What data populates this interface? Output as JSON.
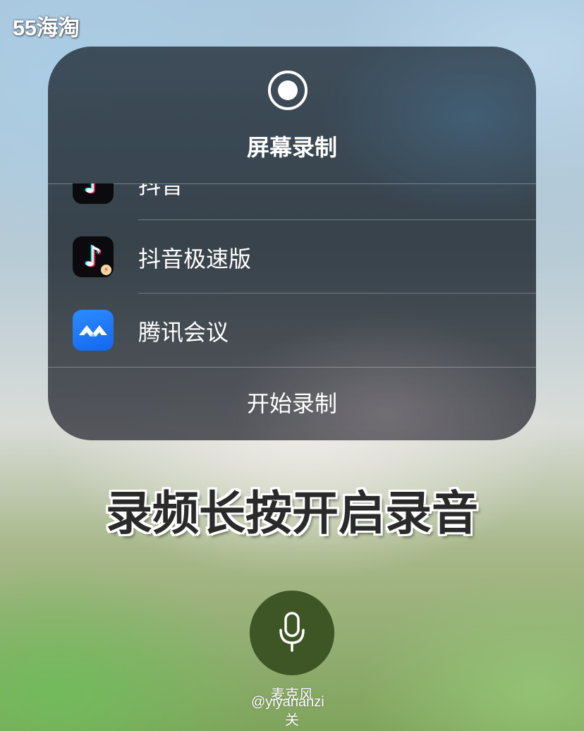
{
  "watermark": "55海淘",
  "panel": {
    "title": "屏幕录制",
    "apps": [
      {
        "label": "抖音",
        "icon": "tiktok-icon"
      },
      {
        "label": "抖音极速版",
        "icon": "tiktok-lite-icon"
      },
      {
        "label": "腾讯会议",
        "icon": "tencent-meeting-icon"
      }
    ],
    "start_label": "开始录制"
  },
  "caption": "录频长按开启录音",
  "microphone": {
    "label": "麦克风",
    "state": "关",
    "icon": "microphone-icon"
  },
  "credit": "@yiyananzi",
  "colors": {
    "panel_bg": "#2e3840",
    "mic_button": "#3e5525",
    "tencent_blue": "#1466f0",
    "tiktok_cyan": "#25f4ee",
    "tiktok_pink": "#fe2c55"
  }
}
